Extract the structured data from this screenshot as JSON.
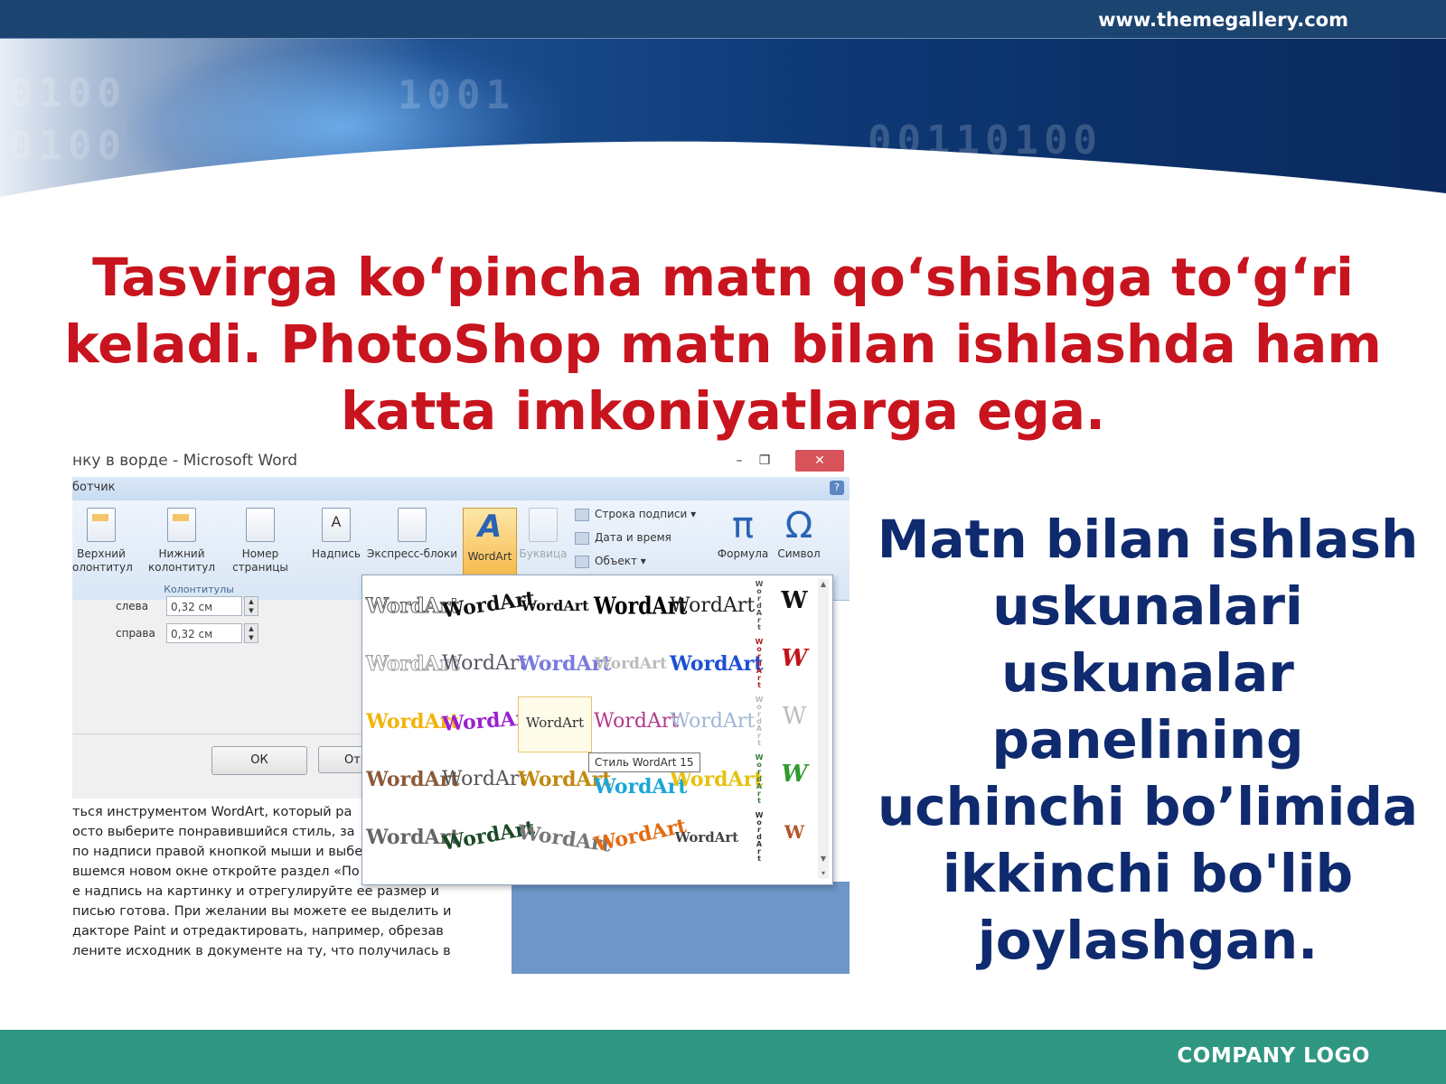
{
  "header": {
    "url": "www.themegallery.com"
  },
  "title": {
    "line1": "Tasvirga ko‘pincha matn qo‘shishga to‘g‘ri",
    "line2": "keladi. PhotoShop matn bilan ishlashda ham",
    "line3": "katta imkoniyatlarga ega."
  },
  "side_text": {
    "lines": [
      "Matn bilan ishlash",
      "uskunalari",
      "uskunalar",
      "panelining",
      "uchinchi bo’limida",
      "ikkinchi bo'lib",
      "joylashgan."
    ]
  },
  "screenshot": {
    "window_title": "нку в ворде - Microsoft Word",
    "tab_label": "ботчик",
    "ribbon": {
      "header_top": "Верхний",
      "header_bottom": "олонтитул",
      "footer_top": "Нижний",
      "footer_bottom": "колонтитул",
      "pagenum_top": "Номер",
      "pagenum_bottom": "страницы",
      "textbox": "Надпись",
      "quickparts": "Экспресс-блоки",
      "wordart": "WordArt",
      "dropcap": "Буквица",
      "signature": "Строка подписи",
      "datetime": "Дата и время",
      "object": "Объект",
      "equation": "Формула",
      "symbol": "Символ",
      "group_label": "Колонтитулы"
    },
    "dialog": {
      "left_label": "слева",
      "left_value": "0,32 см",
      "right_label": "справа",
      "right_value": "0,32 см",
      "ok_label": "ОК",
      "cancel_label": "От"
    },
    "gallery": {
      "cell_text": "WordArt",
      "w_text": "W",
      "vertical_text": "WordArt",
      "tooltip": "Стиль WordArt 15"
    },
    "article_lines": [
      "ться инструментом WordArt, который ра",
      "осто выберите понравившийся стиль, за",
      "по надписи правой кнопкой мыши и выбе",
      "вшемся новом окне откройте раздел «По",
      "е надпись на картинку и отрегулируйте ее размер и",
      "писью готова. При желании вы можете ее выделить и",
      "дакторе Paint и отредактировать, например, обрезав",
      "лените исходник в документе на ту, что получилась в"
    ]
  },
  "footer": {
    "logo": "COMPANY LOGO"
  },
  "colors": {
    "title_red": "#c8141e",
    "side_navy": "#0f2a6e",
    "footer_teal": "#2f9682",
    "header_blue": "#0e3a78"
  }
}
